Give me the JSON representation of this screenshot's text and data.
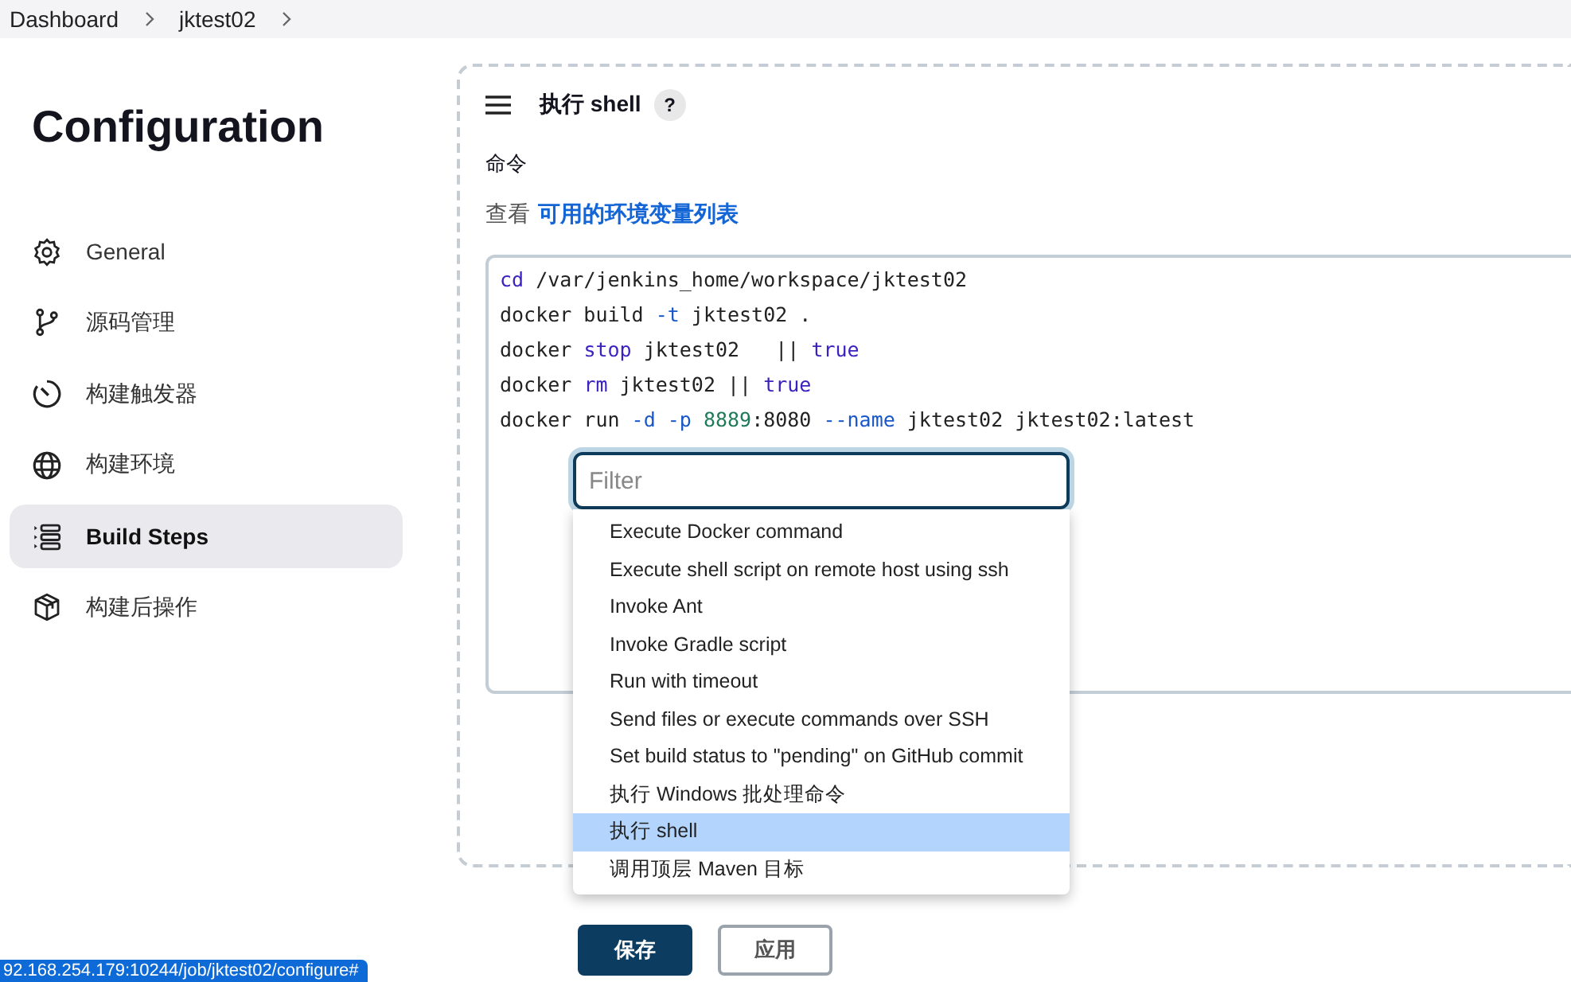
{
  "breadcrumb": [
    {
      "label": "Dashboard"
    },
    {
      "label": "jktest02"
    }
  ],
  "sidebar": {
    "title": "Configuration",
    "items": [
      {
        "label": "General",
        "selected": false
      },
      {
        "label": "源码管理",
        "selected": false
      },
      {
        "label": "构建触发器",
        "selected": false
      },
      {
        "label": "构建环境",
        "selected": false
      },
      {
        "label": "Build Steps",
        "selected": true
      },
      {
        "label": "构建后操作",
        "selected": false
      }
    ]
  },
  "step": {
    "title": "执行 shell",
    "help": "?",
    "command_label": "命令",
    "env_prefix": "查看",
    "env_link": "可用的环境变量列表",
    "code": [
      [
        {
          "text": "cd",
          "kind": "keyword"
        },
        {
          "text": " /var/jenkins_home/workspace/jktest02",
          "kind": "plain"
        }
      ],
      [
        {
          "text": "docker build ",
          "kind": "plain"
        },
        {
          "text": "-t",
          "kind": "option"
        },
        {
          "text": " jktest02 .",
          "kind": "plain"
        }
      ],
      [
        {
          "text": "docker ",
          "kind": "plain"
        },
        {
          "text": "stop",
          "kind": "keyword"
        },
        {
          "text": " jktest02   || ",
          "kind": "plain"
        },
        {
          "text": "true",
          "kind": "keyword"
        }
      ],
      [
        {
          "text": "docker ",
          "kind": "plain"
        },
        {
          "text": "rm",
          "kind": "keyword"
        },
        {
          "text": " jktest02 || ",
          "kind": "plain"
        },
        {
          "text": "true",
          "kind": "keyword"
        }
      ],
      [
        {
          "text": "docker run ",
          "kind": "plain"
        },
        {
          "text": "-d -p ",
          "kind": "option"
        },
        {
          "text": "8889",
          "kind": "number"
        },
        {
          "text": ":8080 ",
          "kind": "plain"
        },
        {
          "text": "--name",
          "kind": "option"
        },
        {
          "text": " jktest02 jktest02:latest",
          "kind": "plain"
        }
      ]
    ]
  },
  "menu": {
    "filter": {
      "placeholder": "Filter"
    },
    "items": [
      {
        "label": "Execute Docker command",
        "selected": false
      },
      {
        "label": "Execute shell script on remote host using ssh",
        "selected": false
      },
      {
        "label": "Invoke Ant",
        "selected": false
      },
      {
        "label": "Invoke Gradle script",
        "selected": false
      },
      {
        "label": "Run with timeout",
        "selected": false
      },
      {
        "label": "Send files or execute commands over SSH",
        "selected": false
      },
      {
        "label": "Set build status to \"pending\" on GitHub commit",
        "selected": false
      },
      {
        "label": "执行 Windows 批处理命令",
        "selected": false
      },
      {
        "label": "执行 shell",
        "selected": true
      },
      {
        "label": "调用顶层 Maven 目标",
        "selected": false
      }
    ]
  },
  "buttons": [
    {
      "label": "保存",
      "kind": "primary"
    },
    {
      "label": "应用",
      "kind": "secondary"
    }
  ],
  "status_url": "92.168.254.179:10244/job/jktest02/configure#"
}
